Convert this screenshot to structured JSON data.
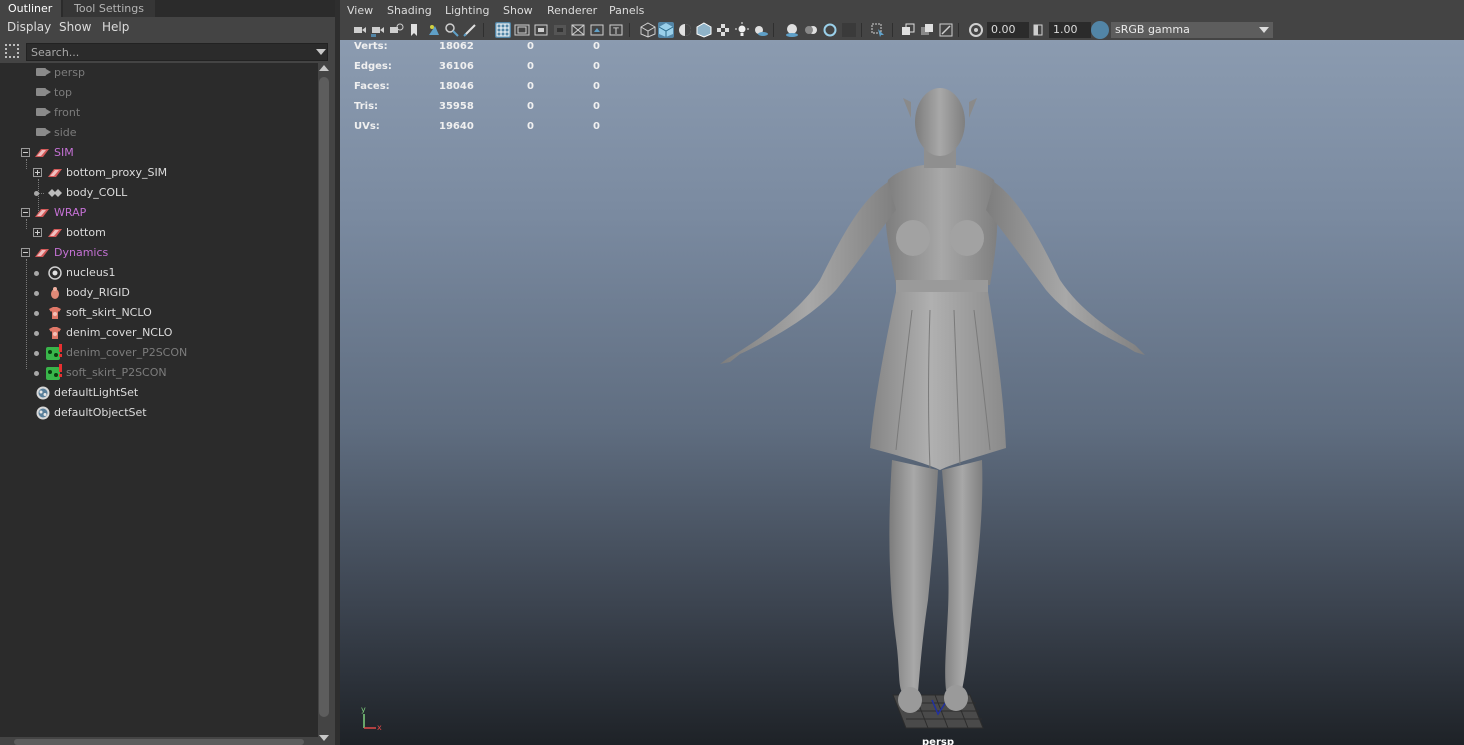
{
  "outliner": {
    "tabs": [
      "Outliner",
      "Tool Settings"
    ],
    "menu": [
      "Display",
      "Show",
      "Help"
    ],
    "search_placeholder": "Search...",
    "items": [
      {
        "label": "persp",
        "icon": "camera-icon"
      },
      {
        "label": "top",
        "icon": "camera-icon"
      },
      {
        "label": "front",
        "icon": "camera-icon"
      },
      {
        "label": "side",
        "icon": "camera-icon"
      },
      {
        "label": "SIM",
        "icon": "group-icon"
      },
      {
        "label": "bottom_proxy_SIM",
        "icon": "mesh-icon"
      },
      {
        "label": "body_COLL",
        "icon": "transform-icon"
      },
      {
        "label": "WRAP",
        "icon": "group-icon"
      },
      {
        "label": "bottom",
        "icon": "mesh-icon"
      },
      {
        "label": "Dynamics",
        "icon": "group-icon"
      },
      {
        "label": "nucleus1",
        "icon": "nucleus-icon"
      },
      {
        "label": "body_RIGID",
        "icon": "rigid-icon"
      },
      {
        "label": "soft_skirt_NCLO",
        "icon": "ncloth-icon"
      },
      {
        "label": "denim_cover_NCLO",
        "icon": "ncloth-icon"
      },
      {
        "label": "denim_cover_P2SCON",
        "icon": "constraint-icon"
      },
      {
        "label": "soft_skirt_P2SCON",
        "icon": "constraint-icon"
      },
      {
        "label": "defaultLightSet",
        "icon": "set-icon"
      },
      {
        "label": "defaultObjectSet",
        "icon": "set-icon"
      }
    ]
  },
  "viewport": {
    "menu": [
      "View",
      "Shading",
      "Lighting",
      "Show",
      "Renderer",
      "Panels"
    ],
    "exposure": "0.00",
    "gamma": "1.00",
    "color_space": "sRGB gamma",
    "camera_label": "persp",
    "hud": [
      {
        "key": "Verts:",
        "v1": "18062",
        "v2": "0",
        "v3": "0"
      },
      {
        "key": "Edges:",
        "v1": "36106",
        "v2": "0",
        "v3": "0"
      },
      {
        "key": "Faces:",
        "v1": "18046",
        "v2": "0",
        "v3": "0"
      },
      {
        "key": "Tris:",
        "v1": "35958",
        "v2": "0",
        "v3": "0"
      },
      {
        "key": "UVs:",
        "v1": "19640",
        "v2": "0",
        "v3": "0"
      }
    ],
    "axis": {
      "y": "y",
      "x": "x"
    }
  },
  "colors": {
    "accent": "#5285a6",
    "group_label": "#c471d4"
  }
}
